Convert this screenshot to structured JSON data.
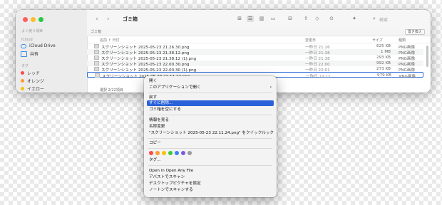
{
  "window": {
    "title": "ゴミ箱",
    "location": "ゴミ箱",
    "save_button": "置き換え",
    "search_placeholder": "検索",
    "footer": "選択 2/22項目"
  },
  "sidebar": {
    "favorites_header": "よく使う項目",
    "icloud_header": "iCloud",
    "shared_header": "",
    "tags_header": "タグ",
    "icloud_drive": "iCloud Drive",
    "shared": "共有",
    "tags": [
      {
        "label": "レッド",
        "color": "#ff4a4a"
      },
      {
        "label": "オレンジ",
        "color": "#ff9a2e"
      },
      {
        "label": "イエロー",
        "color": "#f5c400"
      }
    ]
  },
  "toolbar": {
    "back_icon": "chevron-left-icon",
    "forward_icon": "chevron-right-icon"
  },
  "table": {
    "headers": {
      "name": "名前 ↑ 日付",
      "date": "変更日",
      "size": "サイズ",
      "kind": "種類"
    },
    "rows": [
      {
        "name": "スクリーンショット 2025-05-23 21.26.30.png",
        "date": "一昨日 21:26",
        "size": "625 KB",
        "kind": "PNG画像"
      },
      {
        "name": "スクリーンショット 2025-05-23 21.38.12.png",
        "date": "一昨日 21:38",
        "size": "1 MB",
        "kind": "PNG画像"
      },
      {
        "name": "スクリーンショット 2025-05-23 21.38.12 (1).png",
        "date": "一昨日 21:38",
        "size": "293 KB",
        "kind": "PNG画像"
      },
      {
        "name": "スクリーンショット 2025-05-23 22.00.30.png",
        "date": "一昨日 22:00",
        "size": "992 KB",
        "kind": "PNG画像"
      },
      {
        "name": "スクリーンショット 2025-05-23 22.00.30 (1).png",
        "date": "一昨日 22:01",
        "size": "273 KB",
        "kind": "PNG画像"
      },
      {
        "name": "スクリーンショット 2025-05-23 22.11.24.png",
        "date": "一昨日 22:11",
        "size": "979 KB",
        "kind": "PNG画像"
      }
    ]
  },
  "context_menu": {
    "open": "開く",
    "open_with": "このアプリケーションで開く",
    "put_back": "戻す",
    "delete_now": "すぐに削除...",
    "empty_trash": "ゴミ箱を空にする",
    "get_info": "情報を見る",
    "rename": "名称変更",
    "quick_look": "\"スクリーンショット 2025-05-23 22.11.24.png\" をクイックルック",
    "copy": "コピー",
    "tag_colors": [
      "#ff4a4a",
      "#ff9a2e",
      "#f5c400",
      "#3cc83c",
      "#3b82f6",
      "#7a5ae0",
      "#9a9a9a"
    ],
    "tags": "タグ...",
    "open_any_file": "Open in Open Any File",
    "avast_scan": "アバストでスキャン",
    "set_desktop": "デスクトップピクチャを設定",
    "norton_scan": "ノートンでスキャンする"
  }
}
